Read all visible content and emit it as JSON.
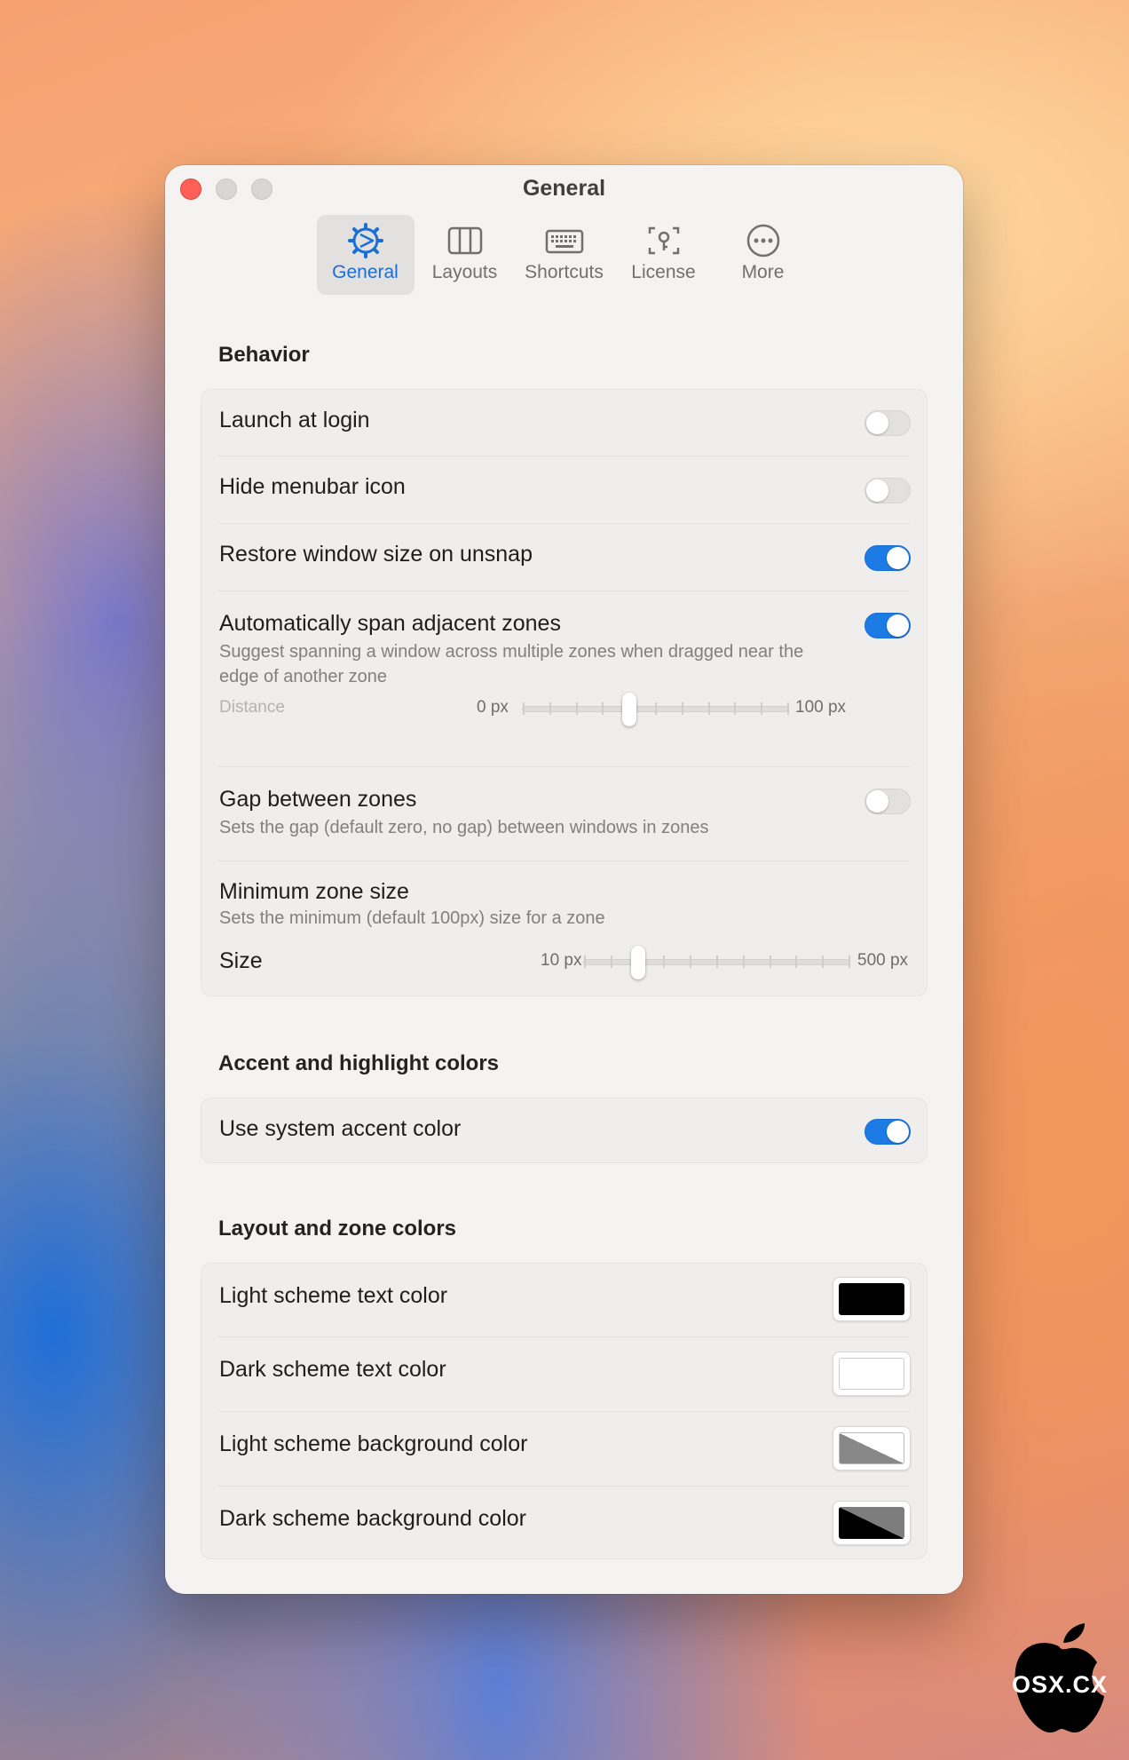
{
  "window": {
    "title": "General"
  },
  "tabs": [
    {
      "label": "General",
      "icon": "gear-icon",
      "active": true
    },
    {
      "label": "Layouts",
      "icon": "columns-icon",
      "active": false
    },
    {
      "label": "Shortcuts",
      "icon": "keyboard-icon",
      "active": false
    },
    {
      "label": "License",
      "icon": "key-icon",
      "active": false
    },
    {
      "label": "More",
      "icon": "ellipsis-icon",
      "active": false
    }
  ],
  "behavior": {
    "title": "Behavior",
    "launch_at_login": {
      "label": "Launch at login",
      "on": false
    },
    "hide_menubar_icon": {
      "label": "Hide menubar icon",
      "on": false
    },
    "restore_window_size": {
      "label": "Restore window size on unsnap",
      "on": true
    },
    "span_adjacent": {
      "label": "Automatically span adjacent zones",
      "sub": "Suggest spanning a window across multiple zones when dragged near the edge of another zone",
      "on": true,
      "distance": {
        "label": "Distance",
        "min_label": "0 px",
        "max_label": "100 px",
        "min": 0,
        "max": 100,
        "value": 40
      }
    },
    "gap_between_zones": {
      "label": "Gap between zones",
      "sub": "Sets the gap (default zero, no gap) between windows in zones",
      "on": false
    },
    "minimum_zone_size": {
      "label": "Minimum zone size",
      "sub": "Sets the minimum (default 100px) size for a zone",
      "size": {
        "label": "Size",
        "min_label": "10 px",
        "max_label": "500 px",
        "min": 10,
        "max": 500,
        "value": 110
      }
    }
  },
  "accent": {
    "title": "Accent and highlight colors",
    "use_system_accent": {
      "label": "Use system accent color",
      "on": true
    }
  },
  "layout_colors": {
    "title": "Layout and zone colors",
    "light_text": {
      "label": "Light scheme text color",
      "color": "#000000"
    },
    "dark_text": {
      "label": "Dark scheme text color",
      "color": "#ffffff"
    },
    "light_bg": {
      "label": "Light scheme background color",
      "color": "#888888"
    },
    "dark_bg": {
      "label": "Dark scheme background color",
      "color": "#000000"
    }
  },
  "watermark": {
    "text": "OSX.CX"
  },
  "colors": {
    "accent": "#1d7be6",
    "close": "#fe5f57"
  }
}
